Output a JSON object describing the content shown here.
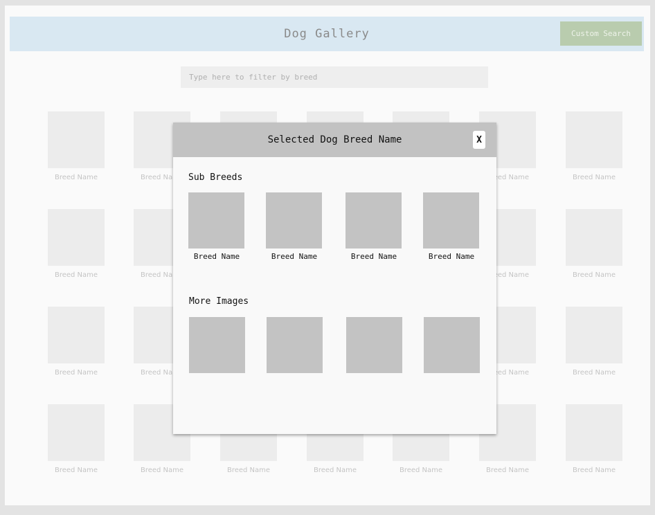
{
  "header": {
    "title": "Dog Gallery",
    "custom_search_label": "Custom Search"
  },
  "filter": {
    "placeholder": "Type here to filter by breed"
  },
  "gallery": {
    "rows": [
      [
        "Breed Name",
        "Breed Name",
        "",
        "",
        "",
        "Breed Name",
        "Breed Name"
      ],
      [
        "Breed Name",
        "Breed Name",
        "",
        "",
        "",
        "Breed Name",
        "Breed Name"
      ],
      [
        "Breed Name",
        "Breed Name",
        "",
        "",
        "",
        "Breed Name",
        "Breed Name"
      ],
      [
        "Breed Name",
        "Breed Name",
        "Breed Name",
        "Breed Name",
        "Breed Name",
        "Breed Name",
        "Breed Name"
      ]
    ]
  },
  "modal": {
    "title": "Selected Dog Breed Name",
    "close_label": "X",
    "sub_breeds_label": "Sub Breeds",
    "sub_breeds": [
      {
        "name": "Breed Name"
      },
      {
        "name": "Breed Name"
      },
      {
        "name": "Breed Name"
      },
      {
        "name": "Breed Name"
      }
    ],
    "more_images_label": "More Images",
    "more_images_count": 4
  }
}
